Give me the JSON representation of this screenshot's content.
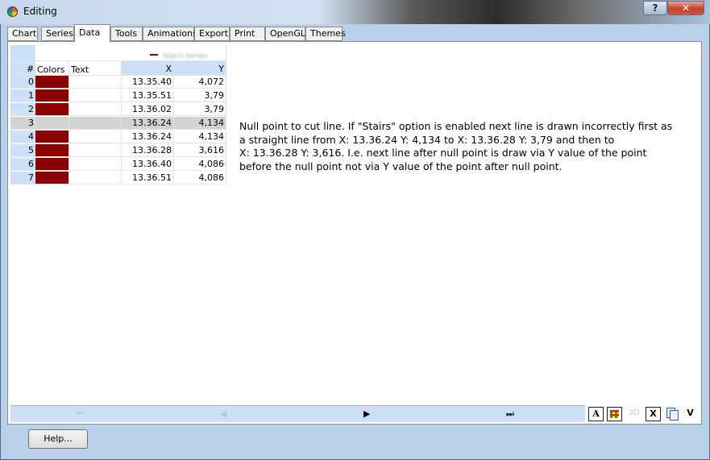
{
  "window": {
    "title": "Editing",
    "help_glyph": "?",
    "close_glyph": "✕"
  },
  "tabs": [
    {
      "label": "Chart"
    },
    {
      "label": "Series"
    },
    {
      "label": "Data",
      "active": true
    },
    {
      "label": "Tools"
    },
    {
      "label": "Animations"
    },
    {
      "label": "Export"
    },
    {
      "label": "Print"
    },
    {
      "label": "OpenGL"
    },
    {
      "label": "Themes"
    }
  ],
  "grid": {
    "series_name": "Stairs series",
    "series_color": "#8b0000",
    "headers": {
      "num": "#",
      "colors": "Colors",
      "text": "Text",
      "x": "X",
      "y": "Y"
    },
    "rows": [
      {
        "num": "0",
        "text": "",
        "x": "13.35.40",
        "y": "4,072",
        "null": false
      },
      {
        "num": "1",
        "text": "",
        "x": "13.35.51",
        "y": "3,79",
        "null": false
      },
      {
        "num": "2",
        "text": "",
        "x": "13.36.02",
        "y": "3,79",
        "null": false
      },
      {
        "num": "3",
        "text": "",
        "x": "13.36.24",
        "y": "4,134",
        "null": true
      },
      {
        "num": "4",
        "text": "",
        "x": "13.36.24",
        "y": "4,134",
        "null": false
      },
      {
        "num": "5",
        "text": "",
        "x": "13.36.28",
        "y": "3,616",
        "null": false
      },
      {
        "num": "6",
        "text": "",
        "x": "13.36.40",
        "y": "4,086",
        "null": false
      },
      {
        "num": "7",
        "text": "",
        "x": "13.36.51",
        "y": "4,086",
        "null": false
      }
    ]
  },
  "annotation": "Null point to cut line. If \"Stairs\" option is enabled next line is drawn incorrectly first as\n a straight line from X: 13.36.24 Y: 4,134 to X: 13.36.28 Y: 3,79 and then to\n X: 13.36.28 Y: 3,616. I.e. next line after null point is draw via Y value of the point\nbefore the null point not via Y value of the point after null point.",
  "navigator": {
    "first": "⏮",
    "prev": "◀",
    "next": "▶",
    "last": "⏭"
  },
  "toolbar": {
    "font_label": "A",
    "three_d_label": "3D",
    "delete_label": "X",
    "view_label": "V"
  },
  "footer": {
    "help_label": "Help..."
  }
}
